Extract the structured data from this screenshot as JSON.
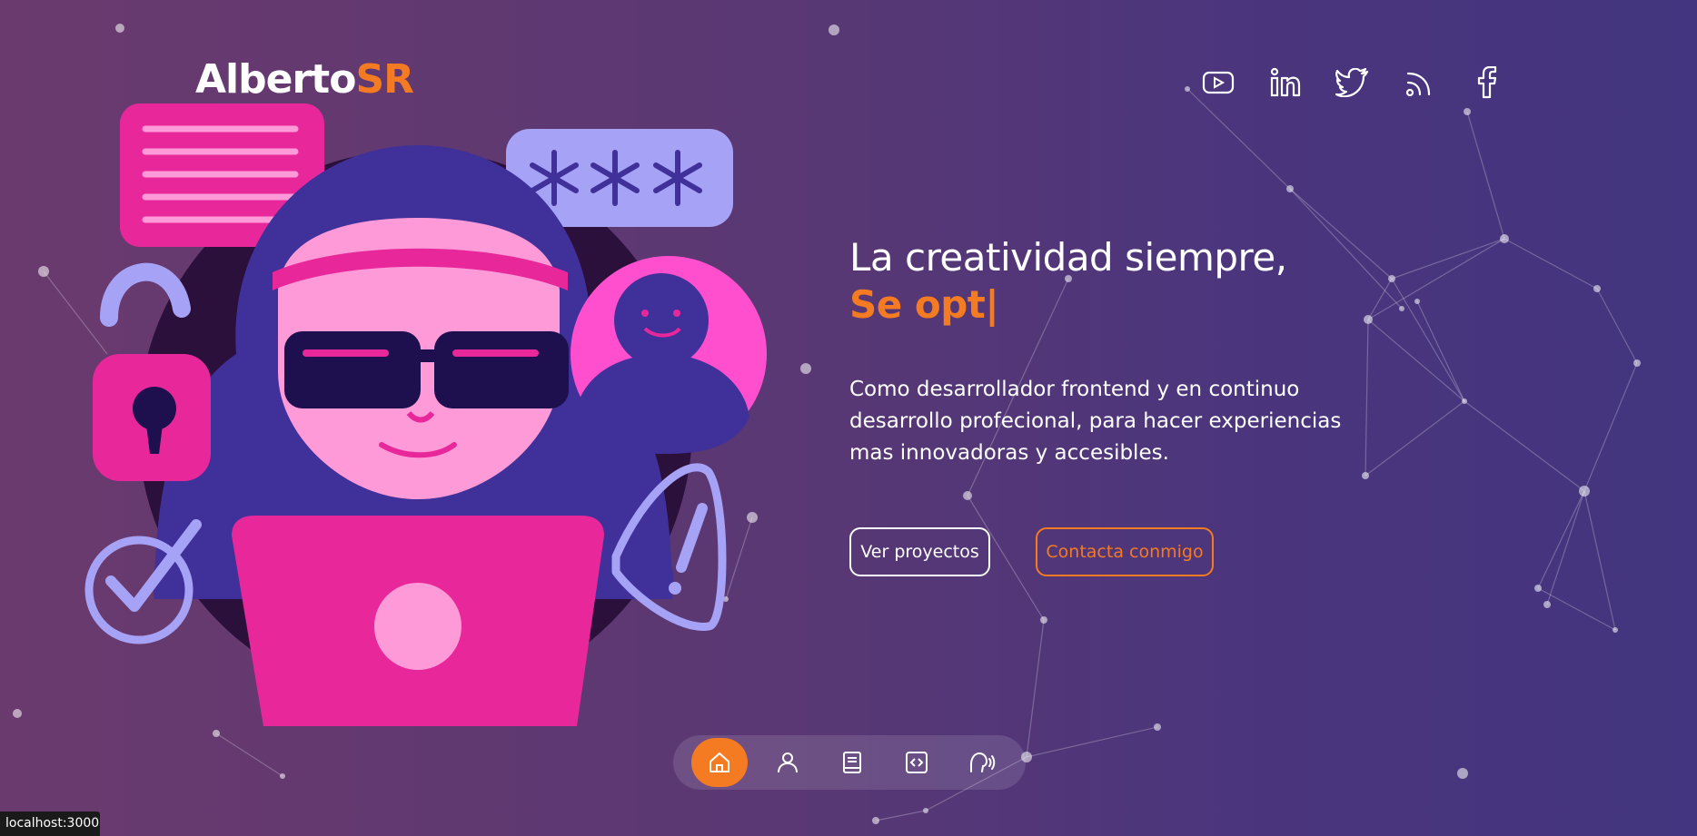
{
  "brand": {
    "part1": "Alberto",
    "part2": "SR"
  },
  "social_links": [
    {
      "name": "youtube-icon"
    },
    {
      "name": "linkedin-icon"
    },
    {
      "name": "twitter-icon"
    },
    {
      "name": "rss-icon"
    },
    {
      "name": "facebook-icon"
    }
  ],
  "hero": {
    "line1": "La creatividad siempre,",
    "line2": "Se opt|",
    "description": "Como desarrollador frontend y en continuo desarrollo profecional, para hacer experiencias mas innovadoras y accesibles.",
    "primary_button": "Ver proyectos",
    "secondary_button": "Contacta conmigo"
  },
  "dock": [
    {
      "name": "home-icon",
      "active": true
    },
    {
      "name": "user-icon",
      "active": false
    },
    {
      "name": "book-icon",
      "active": false
    },
    {
      "name": "code-icon",
      "active": false
    },
    {
      "name": "contact-icon",
      "active": false
    }
  ],
  "status_bar": "localhost:3000",
  "colors": {
    "accent": "#f47b22",
    "text": "#ffffff",
    "illustration_pink": "#e8289a",
    "illustration_purple": "#40309a"
  }
}
